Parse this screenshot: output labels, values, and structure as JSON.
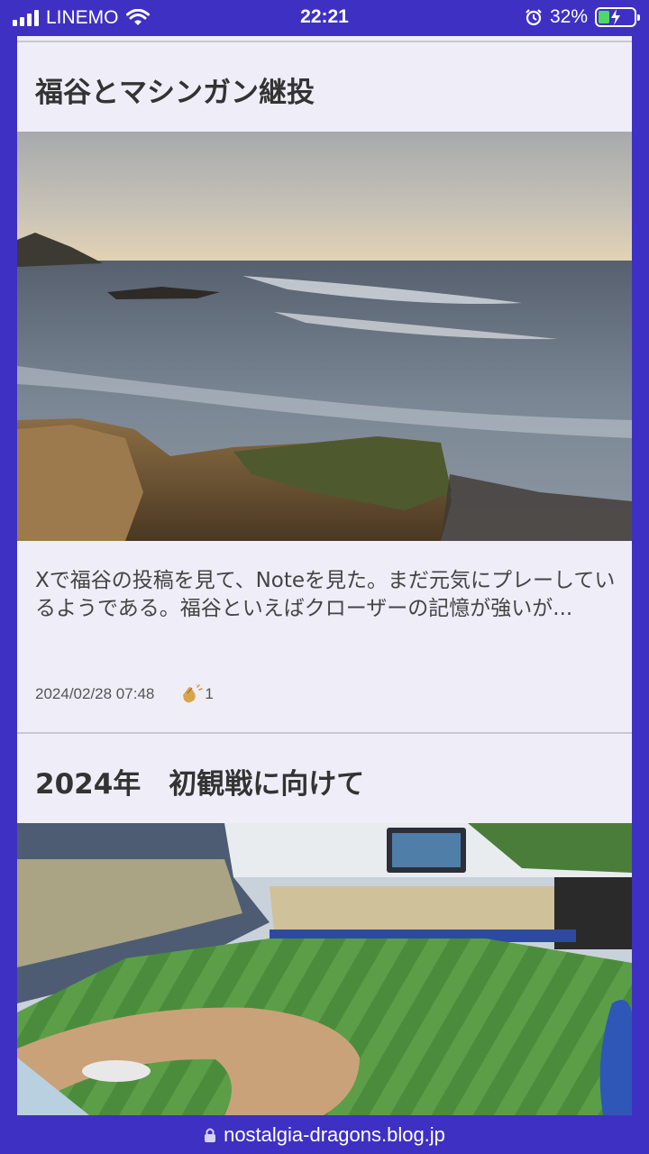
{
  "status_bar": {
    "carrier": "LINEMO",
    "time": "22:21",
    "battery_percent": "32%",
    "battery_level": 0.32
  },
  "posts": [
    {
      "title": "福谷とマシンガン継投",
      "image": "coastal-sunset-rocks",
      "excerpt": "Xで福谷の投稿を見て、Noteを見た。まだ元気にプレーしているようである。福谷といえばクローザーの記憶が強いが...",
      "date": "2024/02/28 07:48",
      "claps": "1"
    },
    {
      "title": "2024年　初観戦に向けて",
      "image": "baseball-stadium-aerial"
    }
  ],
  "url_bar": {
    "domain": "nostalgia-dragons.blog.jp",
    "icon": "lock-icon"
  },
  "colors": {
    "frame": "#3f30c4",
    "card_bg": "#efedf8",
    "battery_fill": "#4cd964"
  }
}
